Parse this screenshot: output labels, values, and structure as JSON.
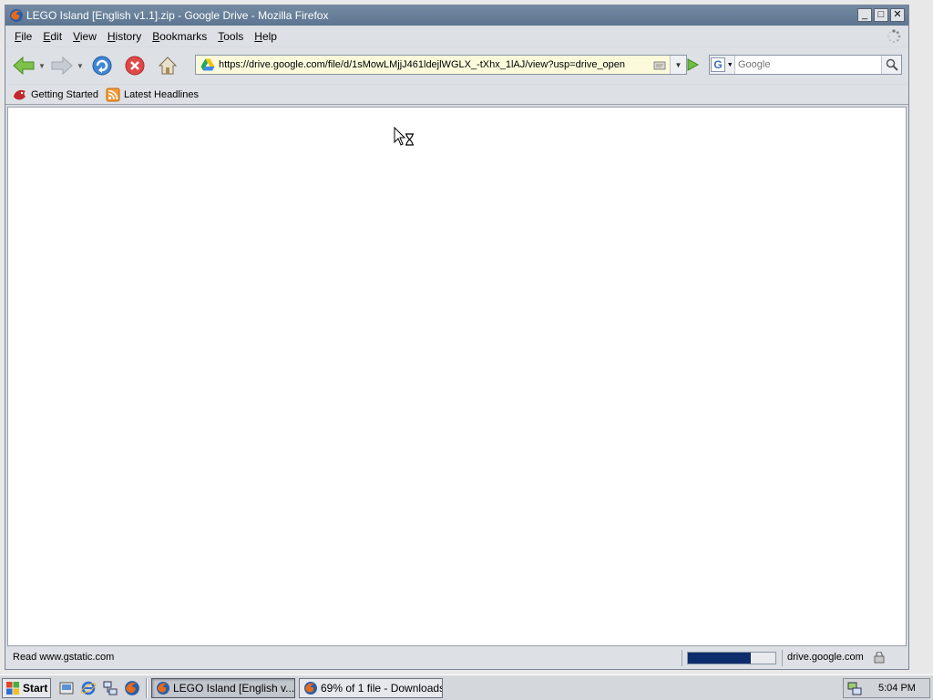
{
  "window": {
    "title": "LEGO Island [English v1.1].zip - Google Drive - Mozilla Firefox",
    "controls": {
      "minimize": "_",
      "maximize": "□",
      "close": "✕"
    }
  },
  "menubar": {
    "items": [
      {
        "label": "File",
        "accel": "F",
        "rest": "ile"
      },
      {
        "label": "Edit",
        "accel": "E",
        "rest": "dit"
      },
      {
        "label": "View",
        "accel": "V",
        "rest": "iew"
      },
      {
        "label": "History",
        "accel": "H",
        "rest": "istory"
      },
      {
        "label": "Bookmarks",
        "accel": "B",
        "rest": "ookmarks"
      },
      {
        "label": "Tools",
        "accel": "T",
        "rest": "ools"
      },
      {
        "label": "Help",
        "accel": "H",
        "rest": "elp"
      }
    ]
  },
  "navbar": {
    "url": "https://drive.google.com/file/d/1sMowLMjjJ461ldejlWGLX_-tXhx_1lAJ/view?usp=drive_open",
    "search_placeholder": "Google",
    "search_engine_letter": "G"
  },
  "bookmarks": [
    {
      "label": "Getting Started",
      "icon": "firefox-getting-started-icon"
    },
    {
      "label": "Latest Headlines",
      "icon": "rss-feed-icon"
    }
  ],
  "statusbar": {
    "text": "Read www.gstatic.com",
    "progress": 0.72,
    "host": "drive.google.com"
  },
  "taskbar": {
    "start_label": "Start",
    "tasks": [
      {
        "label": "LEGO Island [English v...",
        "active": true
      },
      {
        "label": "69% of 1 file - Downloads",
        "active": false
      }
    ],
    "clock": "5:04 PM"
  },
  "colors": {
    "titlebar": "#5c7590",
    "progress_fill": "#0d2c6b",
    "urlbar_bg": "#fbfbdc"
  }
}
